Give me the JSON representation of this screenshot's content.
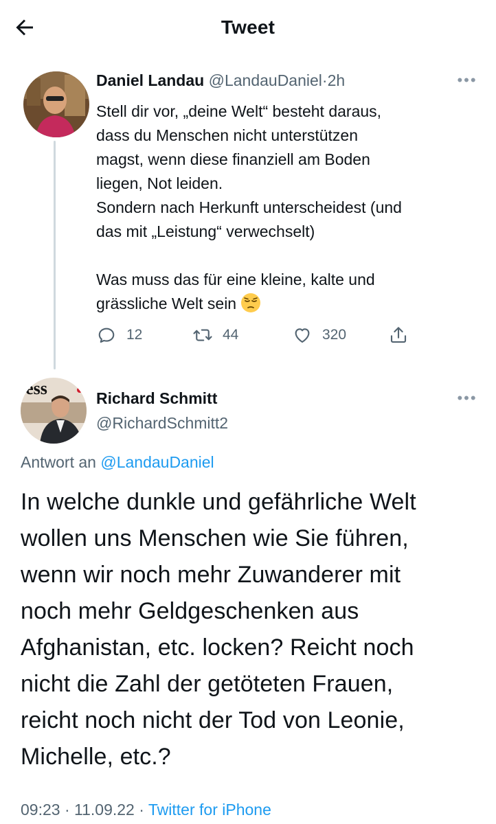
{
  "header": {
    "title": "Tweet"
  },
  "tweet1": {
    "name": "Daniel Landau",
    "handle": "@LandauDaniel",
    "separator": "·",
    "time": "2h",
    "lines": [
      "Stell dir vor, „deine Welt“ besteht daraus,",
      "dass du Menschen nicht unterstützen",
      "magst, wenn diese finanziell am Boden",
      "liegen, Not leiden.",
      "Sondern nach Herkunft unterscheidest (und",
      "das mit „Leistung“ verwechselt)",
      "Was muss das für eine kleine, kalte und",
      "grässliche Welt sein"
    ],
    "emoji": "pensive-face-emoji",
    "replies": "12",
    "retweets": "44",
    "likes": "320"
  },
  "tweet2": {
    "name": "Richard Schmitt",
    "handle": "@RichardSchmitt2",
    "reply_prefix": "Antwort an",
    "reply_mention": "@LandauDaniel",
    "lines": [
      "In welche dunkle und gefährliche Welt",
      "wollen uns Menschen wie Sie führen,",
      "wenn wir noch mehr Zuwanderer mit",
      "noch mehr Geldgeschenken aus",
      "Afghanistan, etc. locken? Reicht noch",
      "nicht die Zahl der getöteten Frauen,",
      "reicht noch nicht der Tod von Leonie,",
      "Michelle, etc.?"
    ],
    "meta_time": "09:23",
    "meta_sep1": "·",
    "meta_date": "11.09.22",
    "meta_sep2": "·",
    "meta_source": "Twitter for iPhone"
  },
  "icons": {
    "back": "arrow-left-icon",
    "more": "more-horizontal-icon",
    "reply": "reply-icon",
    "retweet": "retweet-icon",
    "like": "heart-icon",
    "share": "share-icon"
  },
  "colors": {
    "accent": "#1d9bf0",
    "secondary_text": "#536471",
    "thread_line": "#cfd9de"
  }
}
